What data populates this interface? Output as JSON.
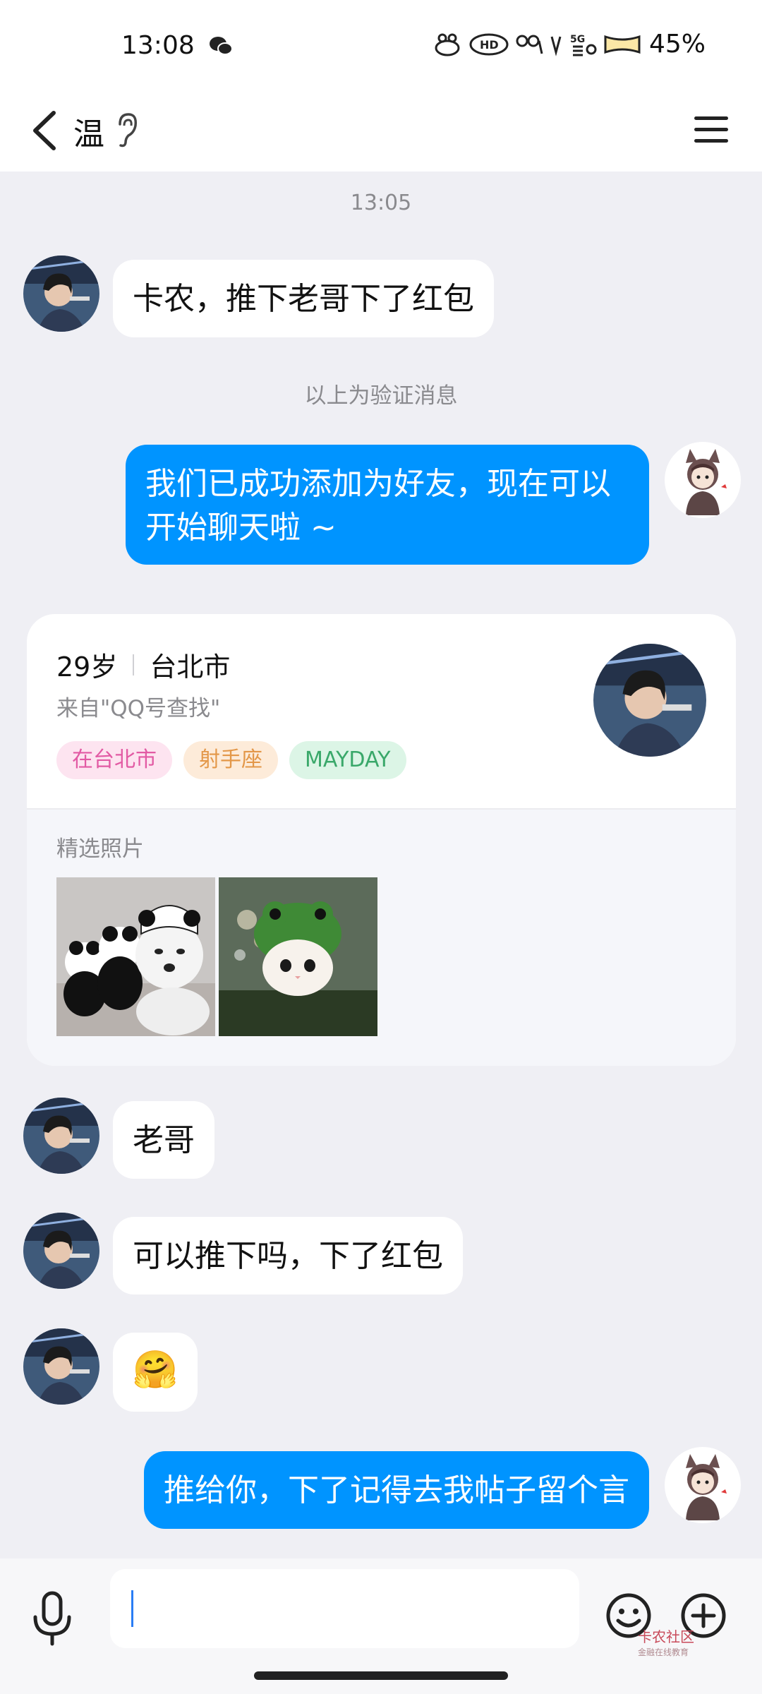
{
  "status_bar": {
    "time": "13:08",
    "battery_percent": "45%",
    "icons": [
      "wechat-icon",
      "hd-icon",
      "signal-icon",
      "5g-icon",
      "battery-icon"
    ]
  },
  "header": {
    "title": "温",
    "back_icon": "chevron-left-icon",
    "ear_icon": "ear-icon",
    "menu_icon": "menu-icon"
  },
  "chat": {
    "timestamp": "13:05",
    "verification_note": "以上为验证消息",
    "messages": [
      {
        "side": "in",
        "text": "卡农，推下老哥下了红包"
      },
      {
        "side": "out",
        "text": "我们已成功添加为好友，现在可以开始聊天啦 ~"
      },
      {
        "side": "in",
        "text": "老哥"
      },
      {
        "side": "in",
        "text": "可以推下吗，下了红包"
      },
      {
        "side": "in",
        "text": "🤗"
      },
      {
        "side": "out",
        "text": "推给你，下了记得去我帖子留个言"
      }
    ]
  },
  "profile_card": {
    "age": "29岁",
    "city": "台北市",
    "source": "来自\"QQ号查找\"",
    "tags": [
      "在台北市",
      "射手座",
      "MAYDAY"
    ],
    "photos_label": "精选照片",
    "photos": [
      "husky-with-pandas-photo",
      "cat-in-frog-hat-photo"
    ]
  },
  "input_bar": {
    "placeholder": "",
    "watermark": "卡农社区",
    "watermark_sub": "金融在线教育"
  },
  "colors": {
    "out_bubble": "#0094ff",
    "background": "#efeff4"
  }
}
